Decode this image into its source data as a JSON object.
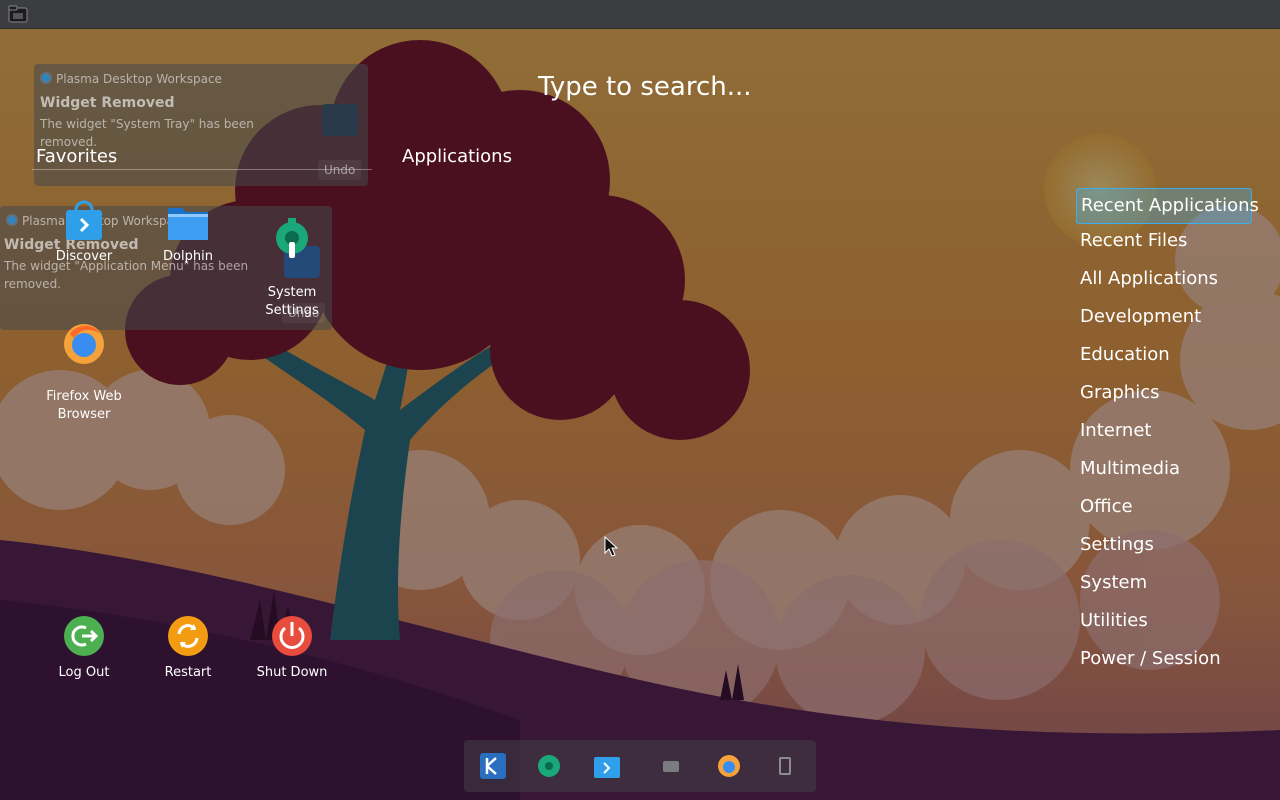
{
  "search": {
    "placeholder": "Type to search..."
  },
  "favorites": {
    "header": "Favorites",
    "items": [
      {
        "label": "Discover",
        "icon": "discover-icon"
      },
      {
        "label": "Dolphin",
        "icon": "folder-icon"
      },
      {
        "label": "System\nSettings",
        "icon": "settings-icon"
      },
      {
        "label": "Firefox Web\nBrowser",
        "icon": "firefox-icon"
      }
    ]
  },
  "applications": {
    "header": "Applications"
  },
  "session": {
    "items": [
      {
        "label": "Log Out",
        "icon": "logout-icon",
        "color": "#4caf50"
      },
      {
        "label": "Restart",
        "icon": "restart-icon",
        "color": "#f39c12"
      },
      {
        "label": "Shut Down",
        "icon": "power-icon",
        "color": "#e74c3c"
      }
    ]
  },
  "categories": [
    {
      "label": "Recent Applications",
      "active": true
    },
    {
      "label": "Recent Files"
    },
    {
      "label": "All Applications"
    },
    {
      "label": "Development"
    },
    {
      "label": "Education"
    },
    {
      "label": "Graphics"
    },
    {
      "label": "Internet"
    },
    {
      "label": "Multimedia"
    },
    {
      "label": "Office"
    },
    {
      "label": "Settings"
    },
    {
      "label": "System"
    },
    {
      "label": "Utilities"
    },
    {
      "label": "Power / Session"
    }
  ],
  "notifications": [
    {
      "app": "Plasma Desktop Workspace",
      "title": "Widget Removed",
      "body": "The widget \"System Tray\" has been removed.",
      "undo": "Undo"
    },
    {
      "app": "Plasma Desktop Workspace",
      "title": "Widget Removed",
      "body": "The widget \"Application Menu\" has been removed.",
      "undo": "Undo"
    }
  ],
  "colors": {
    "accent": "#3daee9",
    "sky": "#e9a24a",
    "tree": "#7a1a34"
  }
}
